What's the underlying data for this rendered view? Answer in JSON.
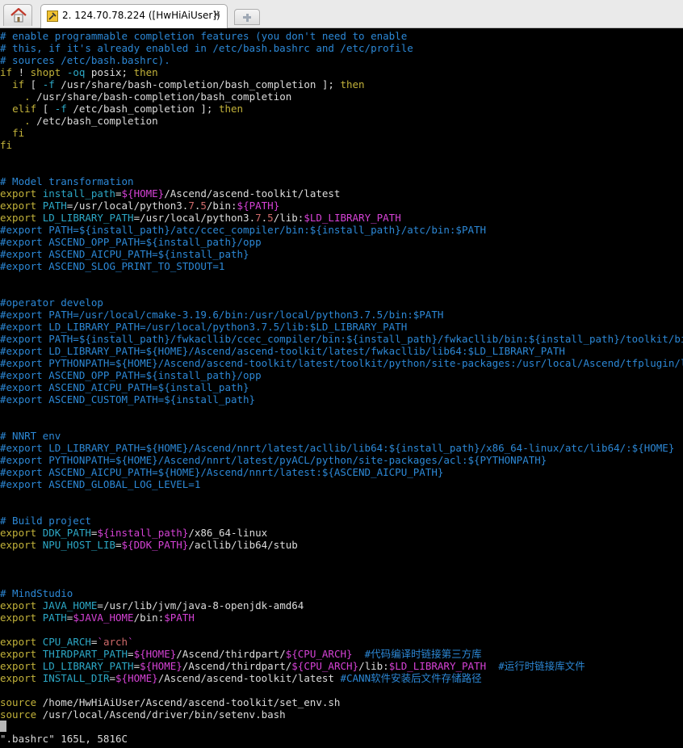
{
  "tab": {
    "title": "2. 124.70.78.224 ([HwHiAiUser])",
    "close_label": "×"
  },
  "colors": {
    "comment": "#2c88d6",
    "keyword": "#c2b23a",
    "identifier": "#2ca8c6",
    "string": "#cf6a6a",
    "special": "#d542d5",
    "text": "#dcdcdc",
    "background": "#000000"
  },
  "icons": [
    "home-icon",
    "terminal-session-icon",
    "close-icon",
    "new-tab-icon"
  ],
  "status_line": "\".bashrc\" 165L, 5816C",
  "lines": [
    [
      [
        "c",
        "# enable programmable completion features (you don't need to enable"
      ]
    ],
    [
      [
        "c",
        "# this, if it's already enabled in /etc/bash.bashrc and /etc/profile"
      ]
    ],
    [
      [
        "c",
        "# sources /etc/bash.bashrc)."
      ]
    ],
    [
      [
        "k",
        "if"
      ],
      [
        "t",
        " ! "
      ],
      [
        "k",
        "shopt"
      ],
      [
        "t",
        " "
      ],
      [
        "v",
        "-oq"
      ],
      [
        "t",
        " posix; "
      ],
      [
        "k",
        "then"
      ]
    ],
    [
      [
        "t",
        "  "
      ],
      [
        "k",
        "if"
      ],
      [
        "t",
        " [ "
      ],
      [
        "v",
        "-f"
      ],
      [
        "t",
        " /usr/share/bash-completion/bash_completion ]; "
      ],
      [
        "k",
        "then"
      ]
    ],
    [
      [
        "t",
        "    "
      ],
      [
        "k",
        "."
      ],
      [
        "t",
        " /usr/share/bash-completion/bash_completion"
      ]
    ],
    [
      [
        "t",
        "  "
      ],
      [
        "k",
        "elif"
      ],
      [
        "t",
        " [ "
      ],
      [
        "v",
        "-f"
      ],
      [
        "t",
        " /etc/bash_completion ]; "
      ],
      [
        "k",
        "then"
      ]
    ],
    [
      [
        "t",
        "    "
      ],
      [
        "k",
        "."
      ],
      [
        "t",
        " /etc/bash_completion"
      ]
    ],
    [
      [
        "t",
        "  "
      ],
      [
        "k",
        "fi"
      ]
    ],
    [
      [
        "k",
        "fi"
      ]
    ],
    [],
    [],
    [
      [
        "c",
        "# Model transformation"
      ]
    ],
    [
      [
        "k",
        "export"
      ],
      [
        "t",
        " "
      ],
      [
        "v",
        "install_path"
      ],
      [
        "t",
        "="
      ],
      [
        "s",
        "${HOME}"
      ],
      [
        "t",
        "/Ascend/ascend-toolkit/latest"
      ]
    ],
    [
      [
        "k",
        "export"
      ],
      [
        "t",
        " "
      ],
      [
        "v",
        "PATH"
      ],
      [
        "t",
        "=/usr/local/python3."
      ],
      [
        "r",
        "7"
      ],
      [
        "t",
        "."
      ],
      [
        "r",
        "5"
      ],
      [
        "t",
        "/bin:"
      ],
      [
        "s",
        "${PATH}"
      ]
    ],
    [
      [
        "k",
        "export"
      ],
      [
        "t",
        " "
      ],
      [
        "v",
        "LD_LIBRARY_PATH"
      ],
      [
        "t",
        "=/usr/local/python3."
      ],
      [
        "r",
        "7"
      ],
      [
        "t",
        "."
      ],
      [
        "r",
        "5"
      ],
      [
        "t",
        "/lib:"
      ],
      [
        "s",
        "$LD_LIBRARY_PATH"
      ]
    ],
    [
      [
        "c",
        "#export PATH=${install_path}/atc/ccec_compiler/bin:${install_path}/atc/bin:$PATH"
      ]
    ],
    [
      [
        "c",
        "#export ASCEND_OPP_PATH=${install_path}/opp"
      ]
    ],
    [
      [
        "c",
        "#export ASCEND_AICPU_PATH=${install_path}"
      ]
    ],
    [
      [
        "c",
        "#export ASCEND_SLOG_PRINT_TO_STDOUT=1"
      ]
    ],
    [],
    [],
    [
      [
        "c",
        "#operator develop"
      ]
    ],
    [
      [
        "c",
        "#export PATH=/usr/local/cmake-3.19.6/bin:/usr/local/python3.7.5/bin:$PATH"
      ]
    ],
    [
      [
        "c",
        "#export LD_LIBRARY_PATH=/usr/local/python3.7.5/lib:$LD_LIBRARY_PATH"
      ]
    ],
    [
      [
        "c",
        "#export PATH=${install_path}/fwkacllib/ccec_compiler/bin:${install_path}/fwkacllib/bin:${install_path}/toolkit/bin:$PATH"
      ]
    ],
    [
      [
        "c",
        "#export LD_LIBRARY_PATH=${HOME}/Ascend/ascend-toolkit/latest/fwkacllib/lib64:$LD_LIBRARY_PATH"
      ]
    ],
    [
      [
        "c",
        "#export PYTHONPATH=${HOME}/Ascend/ascend-toolkit/latest/toolkit/python/site-packages:/usr/local/Ascend/tfplugin/latest"
      ]
    ],
    [
      [
        "c",
        "#export ASCEND_OPP_PATH=${install_path}/opp"
      ]
    ],
    [
      [
        "c",
        "#export ASCEND_AICPU_PATH=${install_path}"
      ]
    ],
    [
      [
        "c",
        "#export ASCEND_CUSTOM_PATH=${install_path}"
      ]
    ],
    [],
    [],
    [
      [
        "c",
        "# NNRT env"
      ]
    ],
    [
      [
        "c",
        "#export LD_LIBRARY_PATH=${HOME}/Ascend/nnrt/latest/acllib/lib64:${install_path}/x86_64-linux/atc/lib64/:${HOME}"
      ]
    ],
    [
      [
        "c",
        "#export PYTHONPATH=${HOME}/Ascend/nnrt/latest/pyACL/python/site-packages/acl:${PYTHONPATH}"
      ]
    ],
    [
      [
        "c",
        "#export ASCEND_AICPU_PATH=${HOME}/Ascend/nnrt/latest:${ASCEND_AICPU_PATH}"
      ]
    ],
    [
      [
        "c",
        "#export ASCEND_GLOBAL_LOG_LEVEL=1"
      ]
    ],
    [],
    [],
    [
      [
        "c",
        "# Build project"
      ]
    ],
    [
      [
        "k",
        "export"
      ],
      [
        "t",
        " "
      ],
      [
        "v",
        "DDK_PATH"
      ],
      [
        "t",
        "="
      ],
      [
        "s",
        "${install_path}"
      ],
      [
        "t",
        "/x86_64-linux"
      ]
    ],
    [
      [
        "k",
        "export"
      ],
      [
        "t",
        " "
      ],
      [
        "v",
        "NPU_HOST_LIB"
      ],
      [
        "t",
        "="
      ],
      [
        "s",
        "${DDK_PATH}"
      ],
      [
        "t",
        "/acllib/lib64/stub"
      ]
    ],
    [],
    [],
    [],
    [
      [
        "c",
        "# MindStudio"
      ]
    ],
    [
      [
        "k",
        "export"
      ],
      [
        "t",
        " "
      ],
      [
        "v",
        "JAVA_HOME"
      ],
      [
        "t",
        "=/usr/lib/jvm/java-8-openjdk-amd64"
      ]
    ],
    [
      [
        "k",
        "export"
      ],
      [
        "t",
        " "
      ],
      [
        "v",
        "PATH"
      ],
      [
        "t",
        "="
      ],
      [
        "s",
        "$JAVA_HOME"
      ],
      [
        "t",
        "/bin:"
      ],
      [
        "s",
        "$PATH"
      ]
    ],
    [],
    [
      [
        "k",
        "export"
      ],
      [
        "t",
        " "
      ],
      [
        "v",
        "CPU_ARCH"
      ],
      [
        "t",
        "="
      ],
      [
        "s",
        "`"
      ],
      [
        "r",
        "arch"
      ],
      [
        "s",
        "`"
      ]
    ],
    [
      [
        "k",
        "export"
      ],
      [
        "t",
        " "
      ],
      [
        "v",
        "THIRDPART_PATH"
      ],
      [
        "t",
        "="
      ],
      [
        "s",
        "${HOME}"
      ],
      [
        "t",
        "/Ascend/thirdpart/"
      ],
      [
        "s",
        "${CPU_ARCH}"
      ],
      [
        "t",
        "  "
      ],
      [
        "c",
        "#代码编译时链接第三方库"
      ]
    ],
    [
      [
        "k",
        "export"
      ],
      [
        "t",
        " "
      ],
      [
        "v",
        "LD_LIBRARY_PATH"
      ],
      [
        "t",
        "="
      ],
      [
        "s",
        "${HOME}"
      ],
      [
        "t",
        "/Ascend/thirdpart/"
      ],
      [
        "s",
        "${CPU_ARCH}"
      ],
      [
        "t",
        "/lib:"
      ],
      [
        "s",
        "$LD_LIBRARY_PATH"
      ],
      [
        "t",
        "  "
      ],
      [
        "c",
        "#运行时链接库文件"
      ]
    ],
    [
      [
        "k",
        "export"
      ],
      [
        "t",
        " "
      ],
      [
        "v",
        "INSTALL_DIR"
      ],
      [
        "t",
        "="
      ],
      [
        "s",
        "${HOME}"
      ],
      [
        "t",
        "/Ascend/ascend-toolkit/latest "
      ],
      [
        "c",
        "#CANN软件安装后文件存储路径"
      ]
    ],
    [],
    [
      [
        "k",
        "source"
      ],
      [
        "t",
        " /home/HwHiAiUser/Ascend/ascend-toolkit/set_env.sh"
      ]
    ],
    [
      [
        "k",
        "source"
      ],
      [
        "t",
        " /usr/local/Ascend/driver/bin/setenv.bash"
      ]
    ]
  ]
}
